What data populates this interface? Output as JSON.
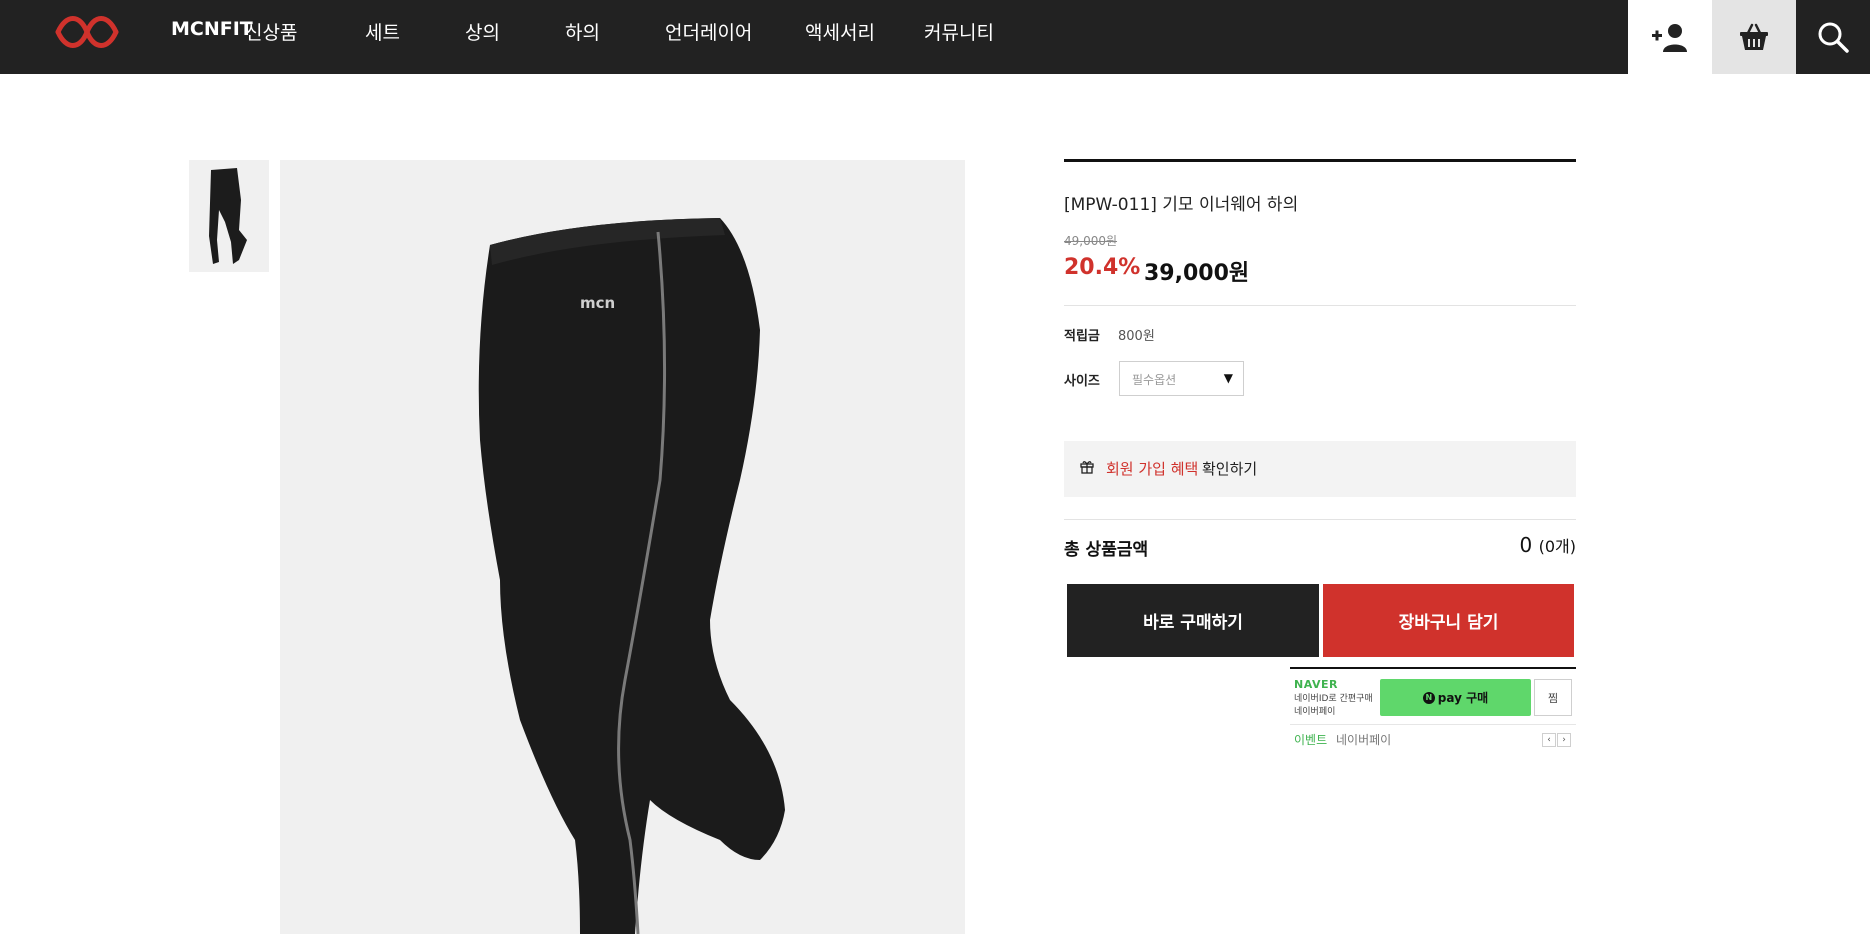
{
  "header": {
    "brand": "MCNFIT",
    "nav": [
      "신상품",
      "세트",
      "상의",
      "하의",
      "언더레이어",
      "액세서리",
      "커뮤니티"
    ],
    "icons": [
      "join-icon",
      "cart-icon",
      "search-icon"
    ],
    "colors": {
      "bar": "#222222",
      "logo": "#d0322c"
    }
  },
  "product": {
    "title": "[MPW-011] 기모 이너웨어 하의",
    "original_price": "49,000원",
    "discount": "20.4%",
    "sale_price": "39,000원",
    "points_label": "적립금",
    "points_value": "800원",
    "size_label": "사이즈",
    "size_placeholder": "필수옵션",
    "benefit_highlight": "회원 가입 혜택",
    "benefit_rest": "확인하기",
    "total_label": "총 상품금액",
    "total_value": "0",
    "total_count": "(0개)",
    "buy_now": "바로 구매하기",
    "add_to_cart": "장바구니 담기",
    "accent_color": "#d0322c"
  },
  "naverpay": {
    "brand": "NAVER",
    "sub": "네이버ID로 간편구매 네이버페이",
    "pay_label": "pay 구매",
    "zzim": "찜",
    "event_label": "이벤트",
    "event_text": "네이버페이",
    "color": "#5fd76b"
  }
}
